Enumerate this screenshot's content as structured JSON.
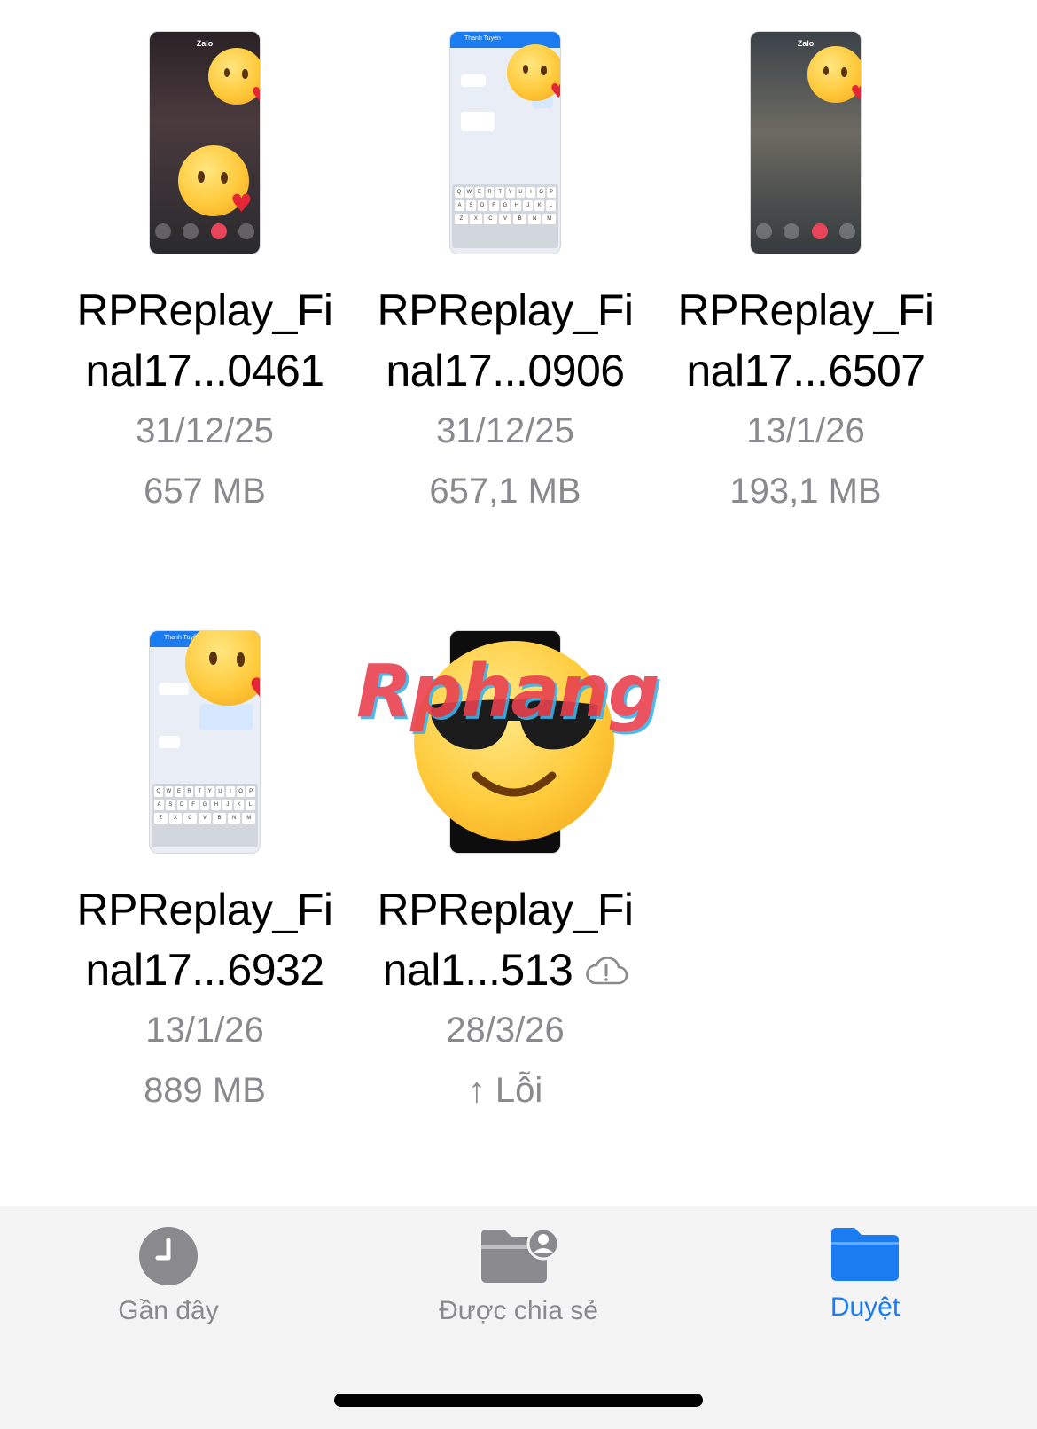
{
  "files": [
    {
      "name_line1": "RPReplay_Fi",
      "name_line2": "nal17...0461",
      "date": "31/12/25",
      "size": "657 MB",
      "thumb_text": "Zalo"
    },
    {
      "name_line1": "RPReplay_Fi",
      "name_line2": "nal17...0906",
      "date": "31/12/25",
      "size": "657,1 MB",
      "thumb_text": "Thanh Tuyền"
    },
    {
      "name_line1": "RPReplay_Fi",
      "name_line2": "nal17...6507",
      "date": "13/1/26",
      "size": "193,1 MB",
      "thumb_text": "Zalo"
    },
    {
      "name_line1": "RPReplay_Fi",
      "name_line2": "nal17...6932",
      "date": "13/1/26",
      "size": "889 MB",
      "thumb_text": "Thanh Tuyền"
    },
    {
      "name_line1": "RPReplay_Fi",
      "name_line2": "nal1...513",
      "date": "28/3/26",
      "status": "↑ Lỗi",
      "cloud_icon": "cloud-alert-icon"
    }
  ],
  "watermark": "Rphang",
  "tabbar": {
    "recents": {
      "label": "Gần đây",
      "icon": "clock-icon"
    },
    "shared": {
      "label": "Được chia sẻ",
      "icon": "shared-folder-icon"
    },
    "browse": {
      "label": "Duyệt",
      "icon": "folder-icon",
      "active": true
    }
  },
  "colors": {
    "accent": "#1a7cf0",
    "secondary_text": "#8a8a8e",
    "tabbar_bg": "#f4f4f5"
  }
}
